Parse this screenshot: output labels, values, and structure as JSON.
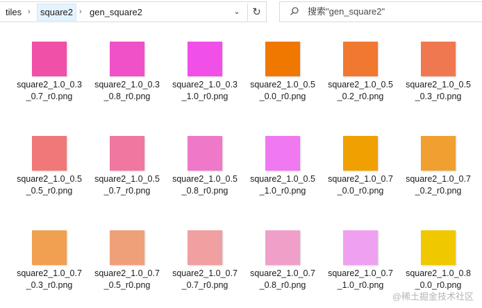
{
  "address_bar": {
    "crumbs": [
      "tiles",
      "square2",
      "gen_square2"
    ]
  },
  "search": {
    "placeholder": "搜索\"gen_square2\""
  },
  "icons": {
    "chevron": "chevron-right-icon",
    "dropdown": "chevron-down-icon",
    "refresh": "refresh-icon",
    "search": "search-icon"
  },
  "files": [
    {
      "line1": "square2_1.0_0.3",
      "line2": "_0.7_r0.png",
      "color": "#f050a8"
    },
    {
      "line1": "square2_1.0_0.3",
      "line2": "_0.8_r0.png",
      "color": "#f050c8"
    },
    {
      "line1": "square2_1.0_0.3",
      "line2": "_1.0_r0.png",
      "color": "#f050e8"
    },
    {
      "line1": "square2_1.0_0.5",
      "line2": "_0.0_r0.png",
      "color": "#f07800"
    },
    {
      "line1": "square2_1.0_0.5",
      "line2": "_0.2_r0.png",
      "color": "#f07830"
    },
    {
      "line1": "square2_1.0_0.5",
      "line2": "_0.3_r0.png",
      "color": "#f07850"
    },
    {
      "line1": "square2_1.0_0.5",
      "line2": "_0.5_r0.png",
      "color": "#f07878"
    },
    {
      "line1": "square2_1.0_0.5",
      "line2": "_0.7_r0.png",
      "color": "#f078a0"
    },
    {
      "line1": "square2_1.0_0.5",
      "line2": "_0.8_r0.png",
      "color": "#f078c8"
    },
    {
      "line1": "square2_1.0_0.5",
      "line2": "_1.0_r0.png",
      "color": "#f078f0"
    },
    {
      "line1": "square2_1.0_0.7",
      "line2": "_0.0_r0.png",
      "color": "#f0a000"
    },
    {
      "line1": "square2_1.0_0.7",
      "line2": "_0.2_r0.png",
      "color": "#f0a030"
    },
    {
      "line1": "square2_1.0_0.7",
      "line2": "_0.3_r0.png",
      "color": "#f0a050"
    },
    {
      "line1": "square2_1.0_0.7",
      "line2": "_0.5_r0.png",
      "color": "#f0a078"
    },
    {
      "line1": "square2_1.0_0.7",
      "line2": "_0.7_r0.png",
      "color": "#f0a0a0"
    },
    {
      "line1": "square2_1.0_0.7",
      "line2": "_0.8_r0.png",
      "color": "#f0a0c8"
    },
    {
      "line1": "square2_1.0_0.7",
      "line2": "_1.0_r0.png",
      "color": "#f0a0f0"
    },
    {
      "line1": "square2_1.0_0.8",
      "line2": "_0.0_r0.png",
      "color": "#f0c800"
    }
  ],
  "watermark": "@稀土掘金技术社区"
}
